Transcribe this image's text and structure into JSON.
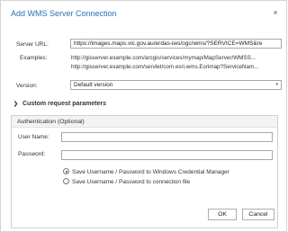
{
  "dialog": {
    "title": "Add WMS Server Connection",
    "close_glyph": "×"
  },
  "server_url": {
    "label": "Server URL:",
    "value": "https://images.maps.vic.gov.au/erdas-iws/ogc/wms/?SERVICE=WMS&re"
  },
  "examples": {
    "label": "Examples:",
    "lines": [
      "http://gisserver.example.com/arcgis/services/mymap/MapServer/WMSS...",
      "http://gisserver.example.com/servlet/com.esri.wms.Esrimap?ServiceNam..."
    ]
  },
  "version": {
    "label": "Version:",
    "selected": "Default version",
    "arrow_glyph": "▾"
  },
  "custom_params": {
    "chevron_glyph": "❯",
    "label": "Custom request parameters"
  },
  "auth": {
    "title": "Authentication (Optional)",
    "username_label": "User Name:",
    "username_value": "",
    "password_label": "Password:",
    "password_value": "",
    "options": [
      "Save Username / Password to Windows Credential Manager",
      "Save Username / Password to connection file"
    ],
    "selected_option": 0
  },
  "buttons": {
    "ok": "OK",
    "cancel": "Cancel"
  }
}
